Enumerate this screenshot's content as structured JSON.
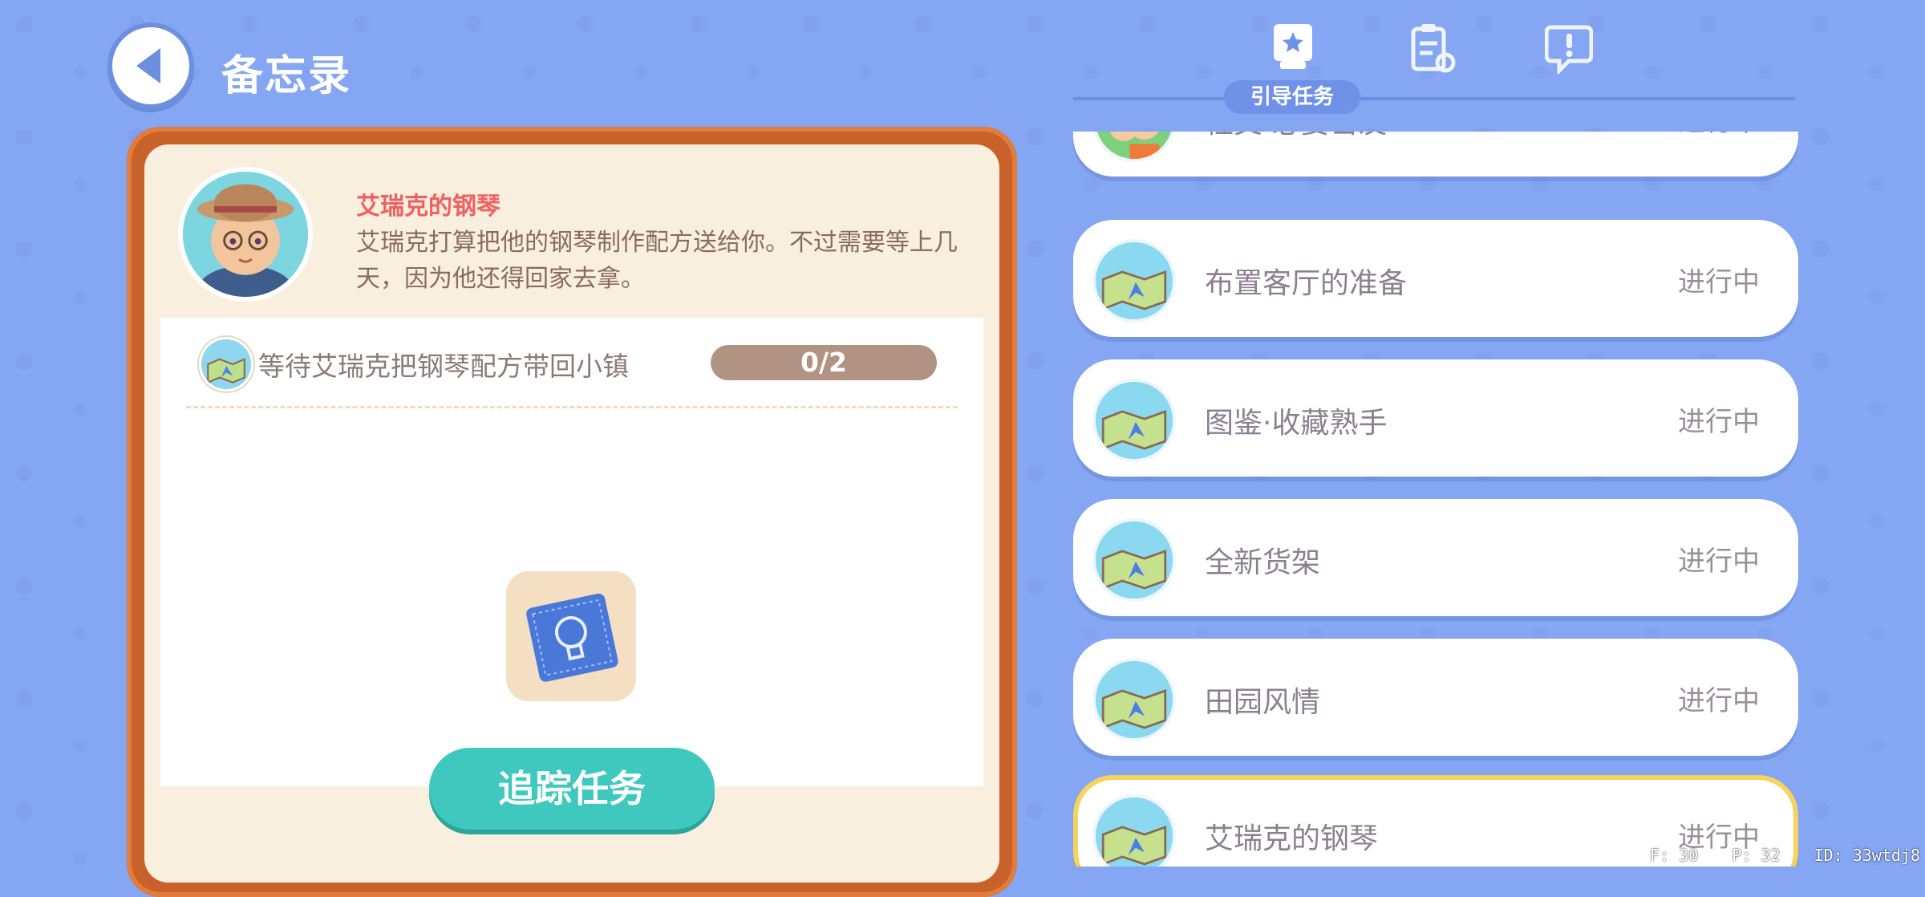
{
  "header": {
    "title": "备忘录",
    "active_tab_label": "引导任务",
    "tabs": [
      {
        "icon": "book-star-icon"
      },
      {
        "icon": "clipboard-refresh-icon"
      },
      {
        "icon": "speech-exclaim-icon"
      }
    ]
  },
  "detail": {
    "npc_name": "艾瑞克的钢琴",
    "description": "艾瑞克打算把他的钢琴制作配方送给你。不过需要等上几天，因为他还得回家去拿。",
    "task_text": "等待艾瑞克把钢琴配方带回小镇",
    "progress": "0/2",
    "progress_fraction": 0,
    "track_button": "追踪任务",
    "reward_icon": "blueprint-lightbulb-icon"
  },
  "quests": [
    {
      "label": "社交·必要密友",
      "status": "进行中"
    },
    {
      "label": "布置客厅的准备",
      "status": "进行中"
    },
    {
      "label": "图鉴·收藏熟手",
      "status": "进行中"
    },
    {
      "label": "全新货架",
      "status": "进行中"
    },
    {
      "label": "田园风情",
      "status": "进行中"
    },
    {
      "label": "艾瑞克的钢琴",
      "status": "进行中"
    }
  ],
  "debug": {
    "f": "F: 30",
    "p": "P: 32",
    "id": "ID: 33wtdj8"
  },
  "colors": {
    "background": "#85a6f2",
    "card_frame": "#c9622a",
    "track_button": "#3fc9be",
    "selected_border": "#f7d35c"
  }
}
